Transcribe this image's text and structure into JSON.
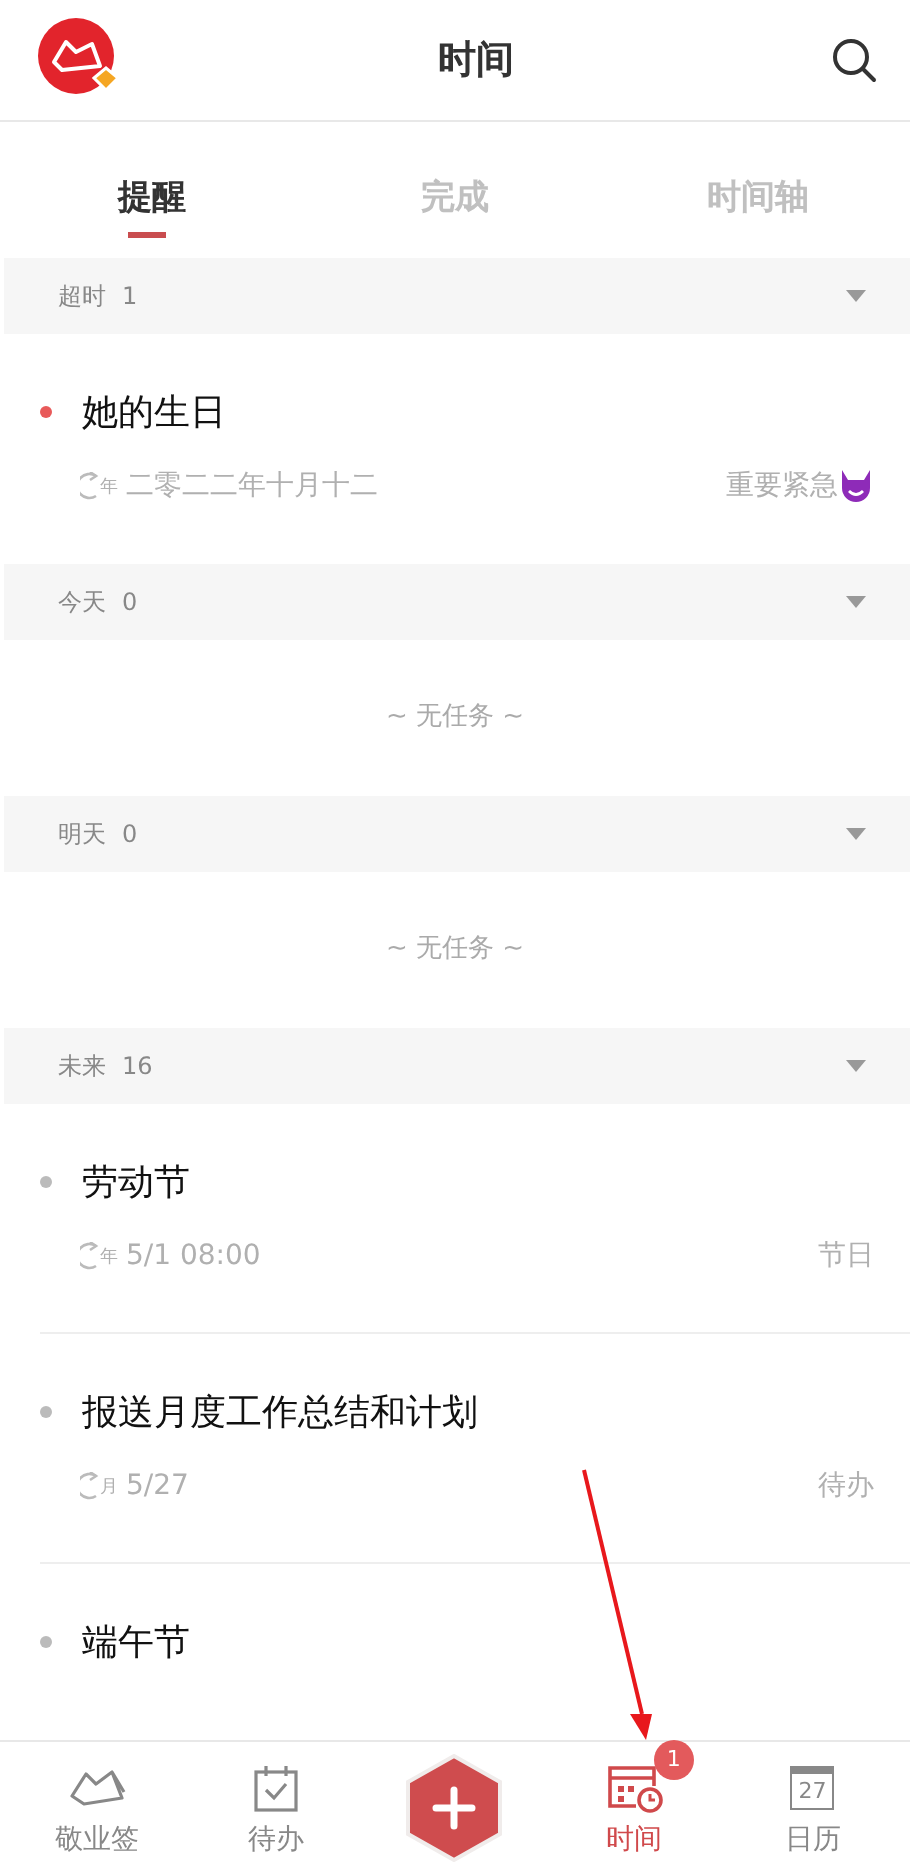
{
  "header": {
    "title": "时间"
  },
  "tabs": [
    {
      "label": "提醒",
      "selected": true
    },
    {
      "label": "完成",
      "selected": false
    },
    {
      "label": "时间轴",
      "selected": false
    }
  ],
  "sections": [
    {
      "label": "超时",
      "count": "1",
      "items": [
        {
          "title": "她的生日",
          "color": "#e85a5a",
          "repeat_mark": "年",
          "date": "二零二二年十月十二",
          "tag": "重要紧急",
          "urgent": true
        }
      ]
    },
    {
      "label": "今天",
      "count": "0",
      "empty_text": "~ 无任务 ~"
    },
    {
      "label": "明天",
      "count": "0",
      "empty_text": "~ 无任务 ~"
    },
    {
      "label": "未来",
      "count": "16",
      "items": [
        {
          "title": "劳动节",
          "color": "#bbbbbb",
          "repeat_mark": "年",
          "date": "5/1 08:00",
          "tag": "节日",
          "urgent": false
        },
        {
          "title": "报送月度工作总结和计划",
          "color": "#bbbbbb",
          "repeat_mark": "月",
          "date": "5/27",
          "tag": "待办",
          "urgent": false
        },
        {
          "title": "端午节",
          "color": "#bbbbbb"
        }
      ]
    }
  ],
  "nav": [
    {
      "kind": "note",
      "label": "敬业签",
      "selected": false
    },
    {
      "kind": "todo",
      "label": "待办",
      "selected": false
    },
    {
      "kind": "add"
    },
    {
      "kind": "time",
      "label": "时间",
      "selected": true,
      "badge": "1"
    },
    {
      "kind": "calendar",
      "label": "日历",
      "selected": false,
      "day": "27"
    }
  ]
}
